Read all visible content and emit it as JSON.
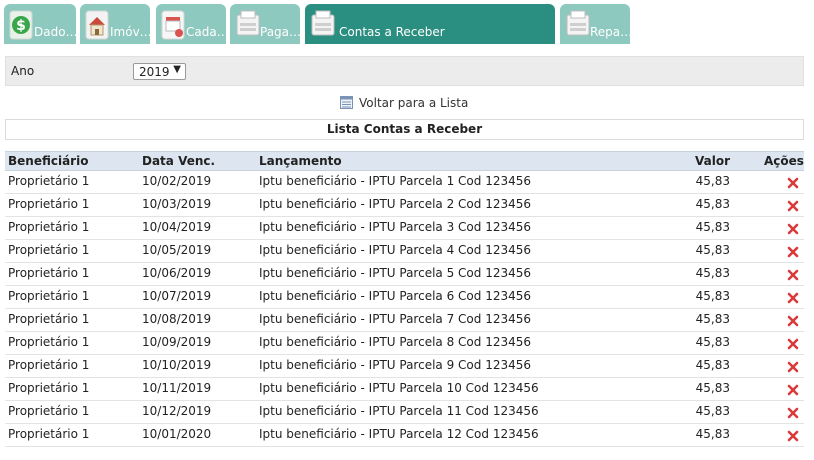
{
  "tabs": [
    {
      "label": "Dado…",
      "icon": "money-icon",
      "active": false
    },
    {
      "label": "Imóv…",
      "icon": "house-icon",
      "active": false
    },
    {
      "label": "Cada…",
      "icon": "calendar-icon",
      "active": false
    },
    {
      "label": "Paga…",
      "icon": "cash-register-icon",
      "active": false
    },
    {
      "label": "Contas a Receber",
      "icon": "cash-register-icon",
      "active": true
    },
    {
      "label": "Repa…",
      "icon": "cash-register-icon",
      "active": false
    }
  ],
  "filter": {
    "label": "Ano",
    "year": "2019"
  },
  "back_link": "Voltar para a Lista",
  "list_title": "Lista Contas a Receber",
  "table": {
    "headers": [
      "Beneficiário",
      "Data Venc.",
      "Lançamento",
      "Valor",
      "Ações"
    ],
    "rows": [
      [
        "Proprietário 1",
        "10/02/2019",
        "Iptu beneficiário - IPTU Parcela 1 Cod 123456",
        "45,83"
      ],
      [
        "Proprietário 1",
        "10/03/2019",
        "Iptu beneficiário - IPTU Parcela 2 Cod 123456",
        "45,83"
      ],
      [
        "Proprietário 1",
        "10/04/2019",
        "Iptu beneficiário - IPTU Parcela 3 Cod 123456",
        "45,83"
      ],
      [
        "Proprietário 1",
        "10/05/2019",
        "Iptu beneficiário - IPTU Parcela 4 Cod 123456",
        "45,83"
      ],
      [
        "Proprietário 1",
        "10/06/2019",
        "Iptu beneficiário - IPTU Parcela 5 Cod 123456",
        "45,83"
      ],
      [
        "Proprietário 1",
        "10/07/2019",
        "Iptu beneficiário - IPTU Parcela 6 Cod 123456",
        "45,83"
      ],
      [
        "Proprietário 1",
        "10/08/2019",
        "Iptu beneficiário - IPTU Parcela 7 Cod 123456",
        "45,83"
      ],
      [
        "Proprietário 1",
        "10/09/2019",
        "Iptu beneficiário - IPTU Parcela 8 Cod 123456",
        "45,83"
      ],
      [
        "Proprietário 1",
        "10/10/2019",
        "Iptu beneficiário - IPTU Parcela 9 Cod 123456",
        "45,83"
      ],
      [
        "Proprietário 1",
        "10/11/2019",
        "Iptu beneficiário - IPTU Parcela 10 Cod 123456",
        "45,83"
      ],
      [
        "Proprietário 1",
        "10/12/2019",
        "Iptu beneficiário - IPTU Parcela 11 Cod 123456",
        "45,83"
      ],
      [
        "Proprietário 1",
        "10/01/2020",
        "Iptu beneficiário - IPTU Parcela 12 Cod 123456",
        "45,83"
      ]
    ],
    "row_action_icon": "delete-x-icon"
  },
  "colors": {
    "tab": "#8ec9bf",
    "tab_active": "#2a8f80",
    "header_bg": "#dde6f0",
    "delete": "#d93a3a"
  }
}
